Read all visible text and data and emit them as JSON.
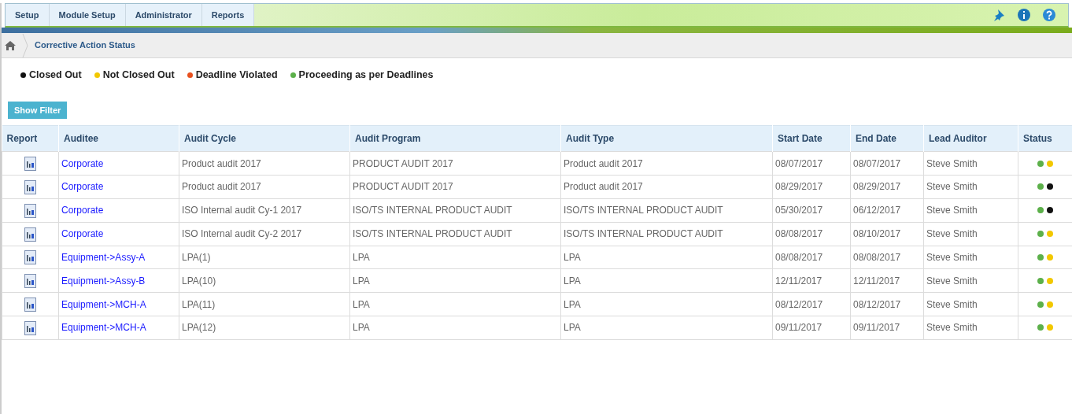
{
  "menu": [
    {
      "label": "Setup",
      "selected": false
    },
    {
      "label": "Module Setup",
      "selected": false
    },
    {
      "label": "Administrator",
      "selected": false
    },
    {
      "label": "Reports",
      "selected": false
    }
  ],
  "breadcrumb": {
    "title": "Corrective Action Status"
  },
  "legend": [
    {
      "label": "Closed Out",
      "color": "#111111"
    },
    {
      "label": "Not Closed Out",
      "color": "#f2c800"
    },
    {
      "label": "Deadline Violated",
      "color": "#e8501e"
    },
    {
      "label": "Proceeding as per Deadlines",
      "color": "#5cb04a"
    }
  ],
  "filter_button": "Show Filter",
  "table": {
    "columns": [
      "Report",
      "Auditee",
      "Audit Cycle",
      "Audit Program",
      "Audit Type",
      "Start Date",
      "End Date",
      "Lead Auditor",
      "Status"
    ],
    "rows": [
      {
        "auditee": "Corporate",
        "cycle": "Product audit 2017",
        "program": "PRODUCT AUDIT 2017",
        "type": "Product audit 2017",
        "start": "08/07/2017",
        "end": "08/07/2017",
        "lead": "Steve Smith",
        "status": [
          {
            "color": "#5cb04a"
          },
          {
            "color": "#f2c800"
          }
        ]
      },
      {
        "auditee": "Corporate",
        "cycle": "Product audit 2017",
        "program": "PRODUCT AUDIT 2017",
        "type": "Product audit 2017",
        "start": "08/29/2017",
        "end": "08/29/2017",
        "lead": "Steve Smith",
        "status": [
          {
            "color": "#5cb04a"
          },
          {
            "color": "#111111"
          }
        ]
      },
      {
        "auditee": "Corporate",
        "cycle": "ISO Internal audit Cy-1 2017",
        "program": "ISO/TS INTERNAL PRODUCT AUDIT",
        "type": "ISO/TS INTERNAL PRODUCT AUDIT",
        "start": "05/30/2017",
        "end": "06/12/2017",
        "lead": "Steve Smith",
        "status": [
          {
            "color": "#5cb04a"
          },
          {
            "color": "#111111"
          }
        ]
      },
      {
        "auditee": "Corporate",
        "cycle": "ISO Internal audit Cy-2 2017",
        "program": "ISO/TS INTERNAL PRODUCT AUDIT",
        "type": "ISO/TS INTERNAL PRODUCT AUDIT",
        "start": "08/08/2017",
        "end": "08/10/2017",
        "lead": "Steve Smith",
        "status": [
          {
            "color": "#5cb04a"
          },
          {
            "color": "#f2c800"
          }
        ]
      },
      {
        "auditee": "Equipment->Assy-A",
        "cycle": "LPA(1)",
        "program": "LPA",
        "type": "LPA",
        "start": "08/08/2017",
        "end": "08/08/2017",
        "lead": "Steve Smith",
        "status": [
          {
            "color": "#5cb04a"
          },
          {
            "color": "#f2c800"
          }
        ]
      },
      {
        "auditee": "Equipment->Assy-B",
        "cycle": "LPA(10)",
        "program": "LPA",
        "type": "LPA",
        "start": "12/11/2017",
        "end": "12/11/2017",
        "lead": "Steve Smith",
        "status": [
          {
            "color": "#5cb04a"
          },
          {
            "color": "#f2c800"
          }
        ]
      },
      {
        "auditee": "Equipment->MCH-A",
        "cycle": "LPA(11)",
        "program": "LPA",
        "type": "LPA",
        "start": "08/12/2017",
        "end": "08/12/2017",
        "lead": "Steve Smith",
        "status": [
          {
            "color": "#5cb04a"
          },
          {
            "color": "#f2c800"
          }
        ]
      },
      {
        "auditee": "Equipment->MCH-A",
        "cycle": "LPA(12)",
        "program": "LPA",
        "type": "LPA",
        "start": "09/11/2017",
        "end": "09/11/2017",
        "lead": "Steve Smith",
        "status": [
          {
            "color": "#5cb04a"
          },
          {
            "color": "#f2c800"
          }
        ]
      }
    ]
  }
}
